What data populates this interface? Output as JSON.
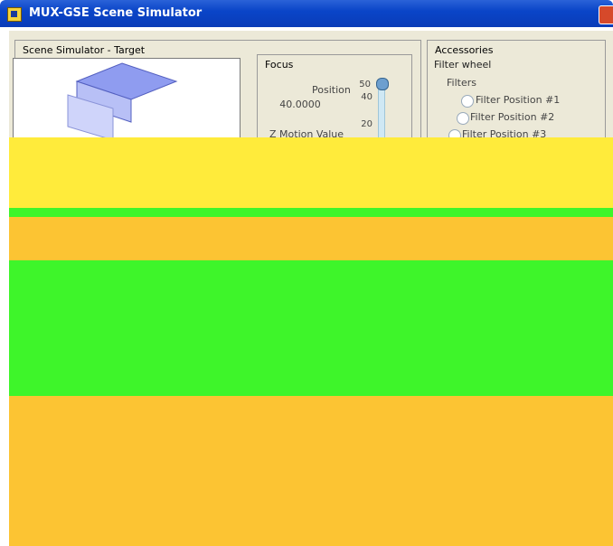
{
  "window": {
    "title": "MUX-GSE Scene Simulator"
  },
  "target_panel": {
    "title": "Scene Simulator - Target"
  },
  "focus": {
    "label": "Focus",
    "position_label": "Position",
    "position_value": "40.0000",
    "z_motion_label": "Z Motion Value",
    "scale_top": "50",
    "scale_mid": "40",
    "scale_low": "20"
  },
  "accessories": {
    "title": "Accessories",
    "filter_wheel_label": "Filter wheel",
    "filters_label": "Filters",
    "options": [
      "Filter Position #1",
      "Filter Position #2",
      "Filter Position #3"
    ]
  },
  "colors": {
    "titlebar": "#0a45c8",
    "yellow": "#ffeb3b",
    "orange": "#fcc433",
    "green": "#3ef52a"
  }
}
